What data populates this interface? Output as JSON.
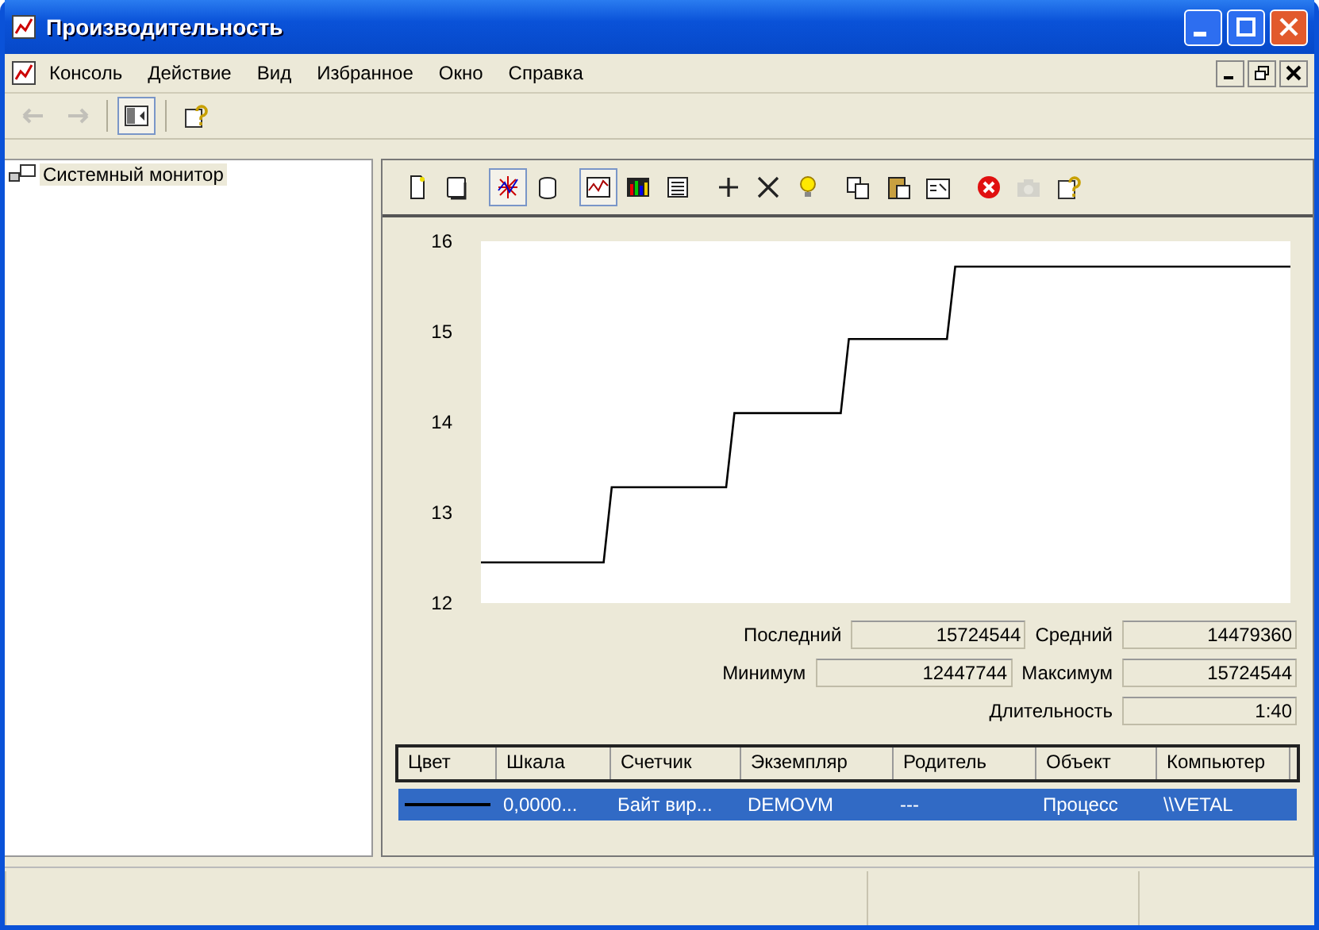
{
  "window": {
    "title": "Производительность"
  },
  "menu": [
    "Консоль",
    "Действие",
    "Вид",
    "Избранное",
    "Окно",
    "Справка"
  ],
  "nav_toolbar": [
    {
      "kind": "back",
      "disabled": true
    },
    {
      "kind": "forward",
      "disabled": true
    },
    {
      "kind": "tree",
      "selected": true
    },
    {
      "kind": "help",
      "selected": false
    }
  ],
  "tree": [
    {
      "label": "Системный монитор",
      "selected": true
    }
  ],
  "monitor_toolbar": [
    {
      "kind": "new",
      "selected": false,
      "disabled": false
    },
    {
      "kind": "clear",
      "selected": false,
      "disabled": false
    },
    {
      "kind": "current",
      "selected": true,
      "disabled": false
    },
    {
      "kind": "log",
      "selected": false,
      "disabled": false
    },
    {
      "kind": "graph",
      "selected": true,
      "disabled": false
    },
    {
      "kind": "histogram",
      "selected": false,
      "disabled": false
    },
    {
      "kind": "report",
      "selected": false,
      "disabled": false
    },
    {
      "kind": "add",
      "selected": false,
      "disabled": false
    },
    {
      "kind": "delete",
      "selected": false,
      "disabled": false
    },
    {
      "kind": "highlight",
      "selected": false,
      "disabled": false
    },
    {
      "kind": "copy",
      "selected": false,
      "disabled": false
    },
    {
      "kind": "paste",
      "selected": false,
      "disabled": false
    },
    {
      "kind": "properties",
      "selected": false,
      "disabled": false
    },
    {
      "kind": "freeze",
      "selected": false,
      "disabled": false
    },
    {
      "kind": "update",
      "selected": false,
      "disabled": true
    },
    {
      "kind": "help",
      "selected": false,
      "disabled": false
    }
  ],
  "chart_data": {
    "type": "line",
    "ylim": [
      12,
      16
    ],
    "yticks": [
      12,
      13,
      14,
      15,
      16
    ],
    "categories": [
      null,
      null,
      null,
      null,
      null,
      null,
      null,
      null,
      null,
      null,
      null,
      null,
      null,
      null,
      null,
      null,
      null,
      null,
      null,
      null,
      null,
      null,
      null,
      null,
      null,
      null,
      null,
      null,
      null,
      null,
      null,
      null,
      null,
      null,
      null,
      null,
      null,
      null,
      null,
      null,
      null,
      null,
      null,
      null,
      null,
      null,
      null,
      null,
      null,
      null,
      null,
      null,
      null,
      null,
      null,
      null,
      null,
      null,
      null,
      null,
      null,
      null,
      null,
      null,
      null,
      null,
      null,
      null,
      null,
      null,
      null,
      null,
      null,
      null,
      null,
      null,
      null,
      null,
      null,
      null,
      null,
      null,
      null,
      null,
      null,
      null,
      null,
      null,
      null,
      null,
      null,
      null,
      null,
      null,
      null,
      null,
      null,
      null,
      null,
      null
    ],
    "series": [
      {
        "color": "#000000",
        "values": [
          12.45,
          12.45,
          12.45,
          12.45,
          12.45,
          12.45,
          12.45,
          12.45,
          12.45,
          12.45,
          12.45,
          12.45,
          12.45,
          12.45,
          12.45,
          12.45,
          13.28,
          13.28,
          13.28,
          13.28,
          13.28,
          13.28,
          13.28,
          13.28,
          13.28,
          13.28,
          13.28,
          13.28,
          13.28,
          13.28,
          13.28,
          14.1,
          14.1,
          14.1,
          14.1,
          14.1,
          14.1,
          14.1,
          14.1,
          14.1,
          14.1,
          14.1,
          14.1,
          14.1,
          14.1,
          14.92,
          14.92,
          14.92,
          14.92,
          14.92,
          14.92,
          14.92,
          14.92,
          14.92,
          14.92,
          14.92,
          14.92,
          14.92,
          15.72,
          15.72,
          15.72,
          15.72,
          15.72,
          15.72,
          15.72,
          15.72,
          15.72,
          15.72,
          15.72,
          15.72,
          15.72,
          15.72,
          15.72,
          15.72,
          15.72,
          15.72,
          15.72,
          15.72,
          15.72,
          15.72,
          15.72,
          15.72,
          15.72,
          15.72,
          15.72,
          15.72,
          15.72,
          15.72,
          15.72,
          15.72,
          15.72,
          15.72,
          15.72,
          15.72,
          15.72,
          15.72,
          15.72,
          15.72,
          15.72,
          15.72
        ]
      }
    ]
  },
  "stats": [
    [
      {
        "label": "Последний",
        "value": "15724544"
      },
      {
        "label": "Средний",
        "value": "14479360"
      }
    ],
    [
      {
        "label": "Минимум",
        "value": "12447744"
      },
      {
        "label": "Максимум",
        "value": "15724544"
      }
    ],
    [
      {
        "label": "Длительность",
        "value": "1:40"
      }
    ]
  ],
  "legend": {
    "columns": [
      "Цвет",
      "Шкала",
      "Счетчик",
      "Экземпляр",
      "Родитель",
      "Объект",
      "Компьютер"
    ],
    "rows": [
      {
        "color": "#000000",
        "cells": [
          "",
          "0,0000...",
          "Байт вир...",
          "DEMOVM",
          "---",
          "Процесс",
          "\\\\VETAL"
        ],
        "selected": true
      }
    ]
  }
}
